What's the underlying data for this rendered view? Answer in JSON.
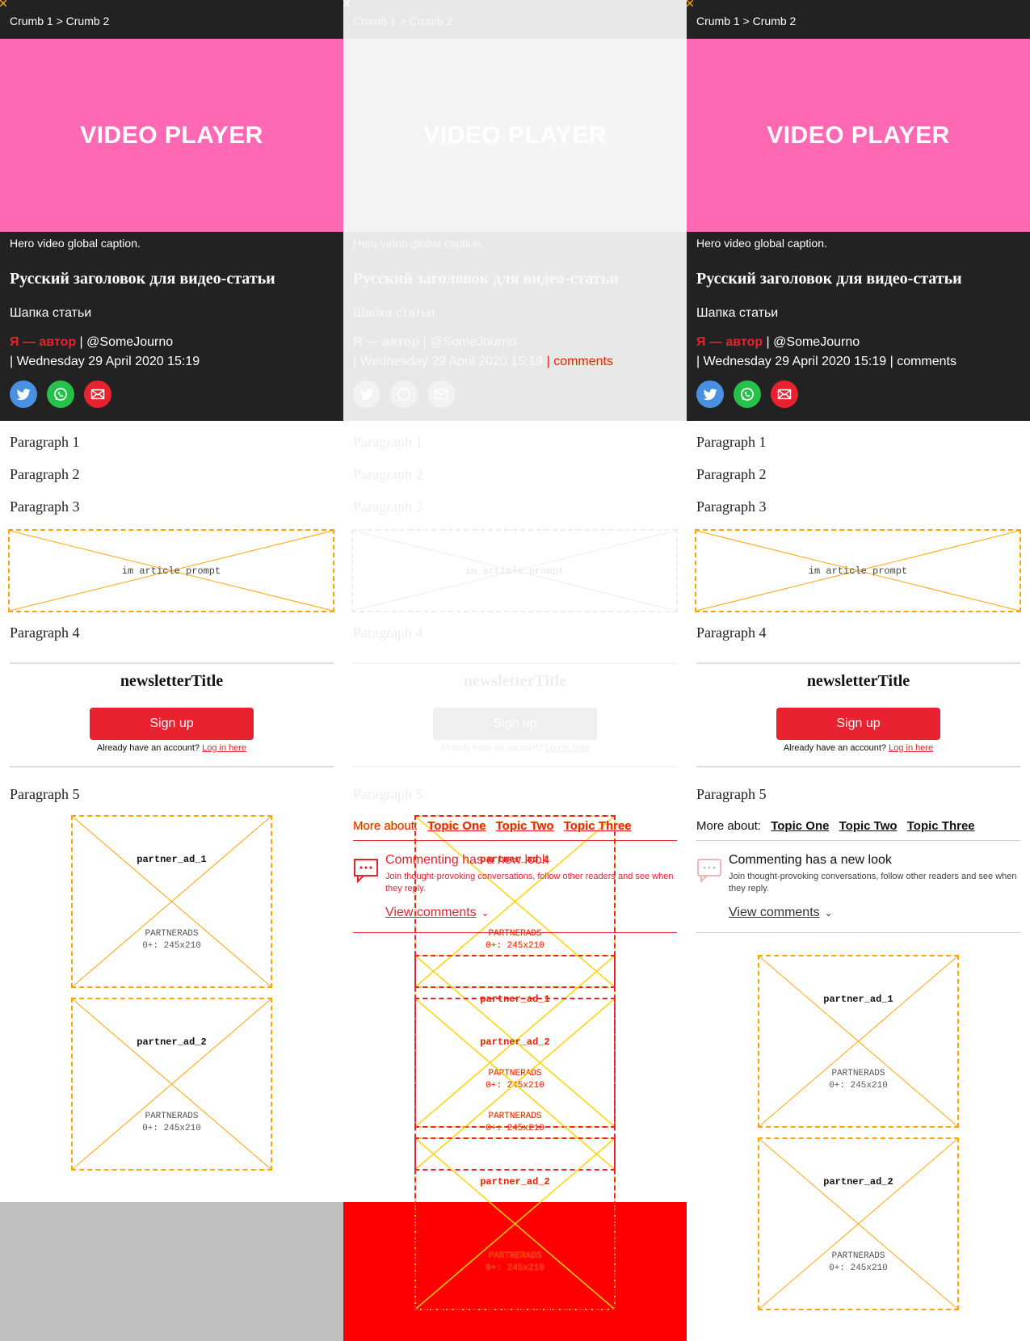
{
  "breadcrumb": {
    "crumb1": "Crumb 1",
    "separator": ">",
    "crumb2": "Crumb 2"
  },
  "video": {
    "label": "VIDEO PLAYER",
    "caption": "Hero video global caption."
  },
  "article": {
    "title": "Русский заголовок для видео-статьи",
    "standfirst": "Шапка статьи",
    "author": "Я — автор",
    "handle": "| @SomeJourno",
    "date": "| Wednesday 29 April 2020 15:19",
    "comments_sep": "|",
    "comments": "comments"
  },
  "share": {
    "twitter_icon": "twitter-icon",
    "whatsapp_icon": "whatsapp-icon",
    "email_icon": "email-icon"
  },
  "paragraphs": [
    "Paragraph 1",
    "Paragraph 2",
    "Paragraph 3",
    "Paragraph 4",
    "Paragraph 5"
  ],
  "prompt": {
    "label": "im article prompt"
  },
  "newsletter": {
    "title": "newsletterTitle",
    "signup": "Sign up",
    "already": "Already have an account?",
    "login": "Log in here"
  },
  "topics": {
    "label": "More about:",
    "items": [
      "Topic One",
      "Topic Two",
      "Topic Three"
    ]
  },
  "commenting": {
    "title": "Commenting has a new look",
    "desc": "Join thought-provoking conversations, follow other readers and see when they reply.",
    "view": "View comments"
  },
  "ads": [
    {
      "name": "partner_ad_1",
      "provider": "PARTNERADS",
      "size": "0+: 245x210"
    },
    {
      "name": "partner_ad_2",
      "provider": "PARTNERADS",
      "size": "0+: 245x210"
    }
  ],
  "colors": {
    "header": "#222222",
    "video": "#ff69b4",
    "accent": "#e8232f",
    "placeholder": "#ffa500",
    "footer_left": "#bfbfbf",
    "footer_mid": "#ff0000"
  }
}
